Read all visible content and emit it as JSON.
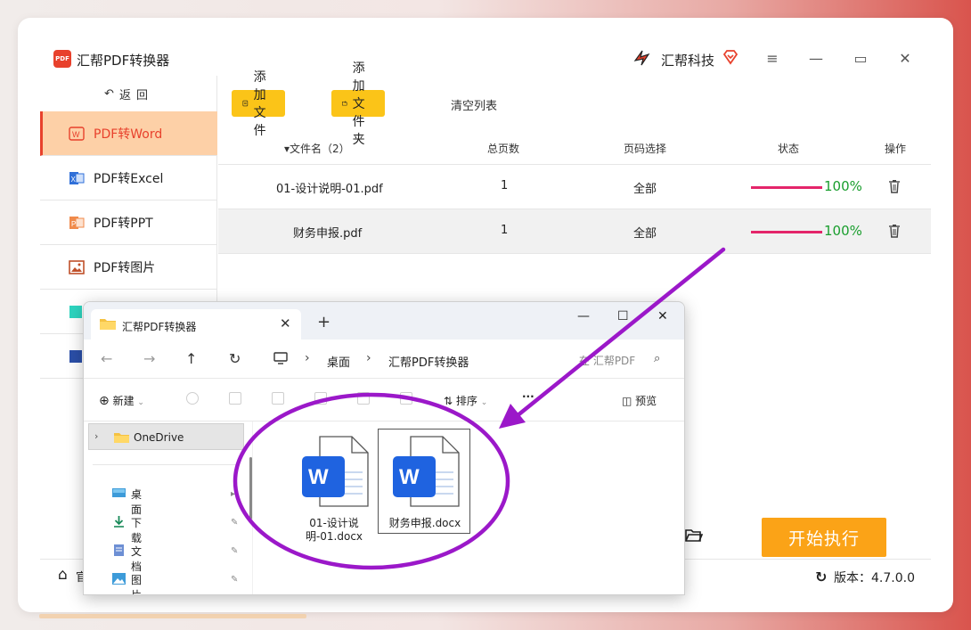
{
  "app": {
    "title": "汇帮PDF转换器",
    "logo_text": "PDF",
    "brand": "汇帮科技",
    "accent": "#e8412c",
    "active_bg": "#fdd0a7"
  },
  "sidebar": {
    "back_label": "返回",
    "items": [
      {
        "label": "PDF转Word",
        "icon": "word-icon",
        "active": true
      },
      {
        "label": "PDF转Excel",
        "icon": "excel-icon",
        "active": false
      },
      {
        "label": "PDF转PPT",
        "icon": "ppt-icon",
        "active": false
      },
      {
        "label": "PDF转图片",
        "icon": "image-icon",
        "active": false
      }
    ]
  },
  "toolbar": {
    "add_file": "添加文件",
    "add_folder": "添加文件夹",
    "clear_list": "清空列表",
    "button_color": "#fbc418"
  },
  "table": {
    "headers": {
      "filename": "▾文件名（2）",
      "pages": "总页数",
      "page_select": "页码选择",
      "status": "状态",
      "action": "操作"
    },
    "rows": [
      {
        "filename": "01-设计说明-01.pdf",
        "pages": "1",
        "page_select": "全部",
        "progress_text": "100%",
        "progress": 1.0
      },
      {
        "filename": "财务申报.pdf",
        "pages": "1",
        "page_select": "全部",
        "progress_text": "100%",
        "progress": 1.0
      }
    ],
    "progress_color": "#e4256a",
    "percent_color": "#1a9e2e"
  },
  "footer": {
    "home_text": "官",
    "start_button": "开始执行",
    "start_color": "#fba317",
    "version_label": "版本：4.7.0.0"
  },
  "explorer": {
    "tab_title": "汇帮PDF转换器",
    "breadcrumb": [
      "桌面",
      "汇帮PDF转换器"
    ],
    "search_placeholder": "在 汇帮PDF",
    "commands": {
      "new": "新建",
      "sort": "排序",
      "more": "···",
      "preview": "预览"
    },
    "nav": {
      "onedrive": "OneDrive",
      "quick_access": [
        {
          "label": "桌面",
          "icon": "desktop-icon"
        },
        {
          "label": "下载",
          "icon": "download-icon"
        },
        {
          "label": "文档",
          "icon": "document-icon"
        },
        {
          "label": "图片",
          "icon": "pictures-icon"
        }
      ]
    },
    "files": [
      {
        "name": "01-设计说明-01.docx",
        "selected": false
      },
      {
        "name": "财务申报.docx",
        "selected": true
      }
    ]
  },
  "annotation": {
    "color": "#9b18c9"
  }
}
